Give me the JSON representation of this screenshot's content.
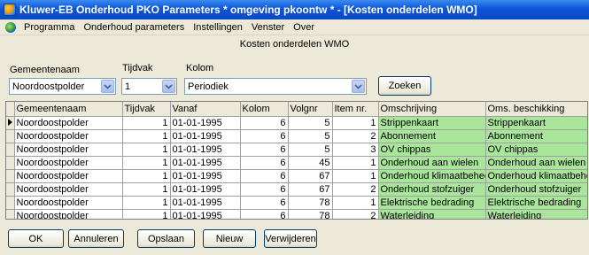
{
  "window": {
    "title": "Kluwer-EB Onderhoud PKO Parameters * omgeving pkoontw * - [Kosten onderdelen WMO]"
  },
  "menubar": {
    "items": [
      "Programma",
      "Onderhoud parameters",
      "Instellingen",
      "Venster",
      "Over"
    ]
  },
  "form": {
    "caption": "Kosten onderdelen WMO"
  },
  "filters": {
    "gemeentenaam_label": "Gemeentenaam",
    "gemeentenaam_value": "Noordoostpolder",
    "tijdvak_label": "Tijdvak",
    "tijdvak_value": "1",
    "kolom_label": "Kolom",
    "kolom_value": "Periodiek",
    "search_label": "Zoeken"
  },
  "grid": {
    "columns": [
      "Gemeentenaam",
      "Tijdvak",
      "Vanaf",
      "Kolom",
      "Volgnr",
      "Item nr.",
      "Omschrijving",
      "Oms. beschikking"
    ],
    "rows": [
      [
        "Noordoostpolder",
        "1",
        "01-01-1995",
        "6",
        "5",
        "1",
        "Strippenkaart",
        "Strippenkaart"
      ],
      [
        "Noordoostpolder",
        "1",
        "01-01-1995",
        "6",
        "5",
        "2",
        "Abonnement",
        "Abonnement"
      ],
      [
        "Noordoostpolder",
        "1",
        "01-01-1995",
        "6",
        "5",
        "3",
        "OV chippas",
        "OV chippas"
      ],
      [
        "Noordoostpolder",
        "1",
        "01-01-1995",
        "6",
        "45",
        "1",
        "Onderhoud aan wielen",
        "Onderhoud aan wielen"
      ],
      [
        "Noordoostpolder",
        "1",
        "01-01-1995",
        "6",
        "67",
        "1",
        "Onderhoud klimaatbeheerser",
        "Onderhoud klimaatbeheerser"
      ],
      [
        "Noordoostpolder",
        "1",
        "01-01-1995",
        "6",
        "67",
        "2",
        "Onderhoud stofzuiger",
        "Onderhoud stofzuiger"
      ],
      [
        "Noordoostpolder",
        "1",
        "01-01-1995",
        "6",
        "78",
        "1",
        "Elektrische bedrading",
        "Elektrische bedrading"
      ],
      [
        "Noordoostpolder",
        "1",
        "01-01-1995",
        "6",
        "78",
        "2",
        "Waterleiding",
        "Waterleiding"
      ]
    ],
    "highlight_color": "#a9e59b"
  },
  "buttons": {
    "ok": "OK",
    "cancel": "Annuleren",
    "save": "Opslaan",
    "new": "Nieuw",
    "delete": "Verwijderen"
  }
}
